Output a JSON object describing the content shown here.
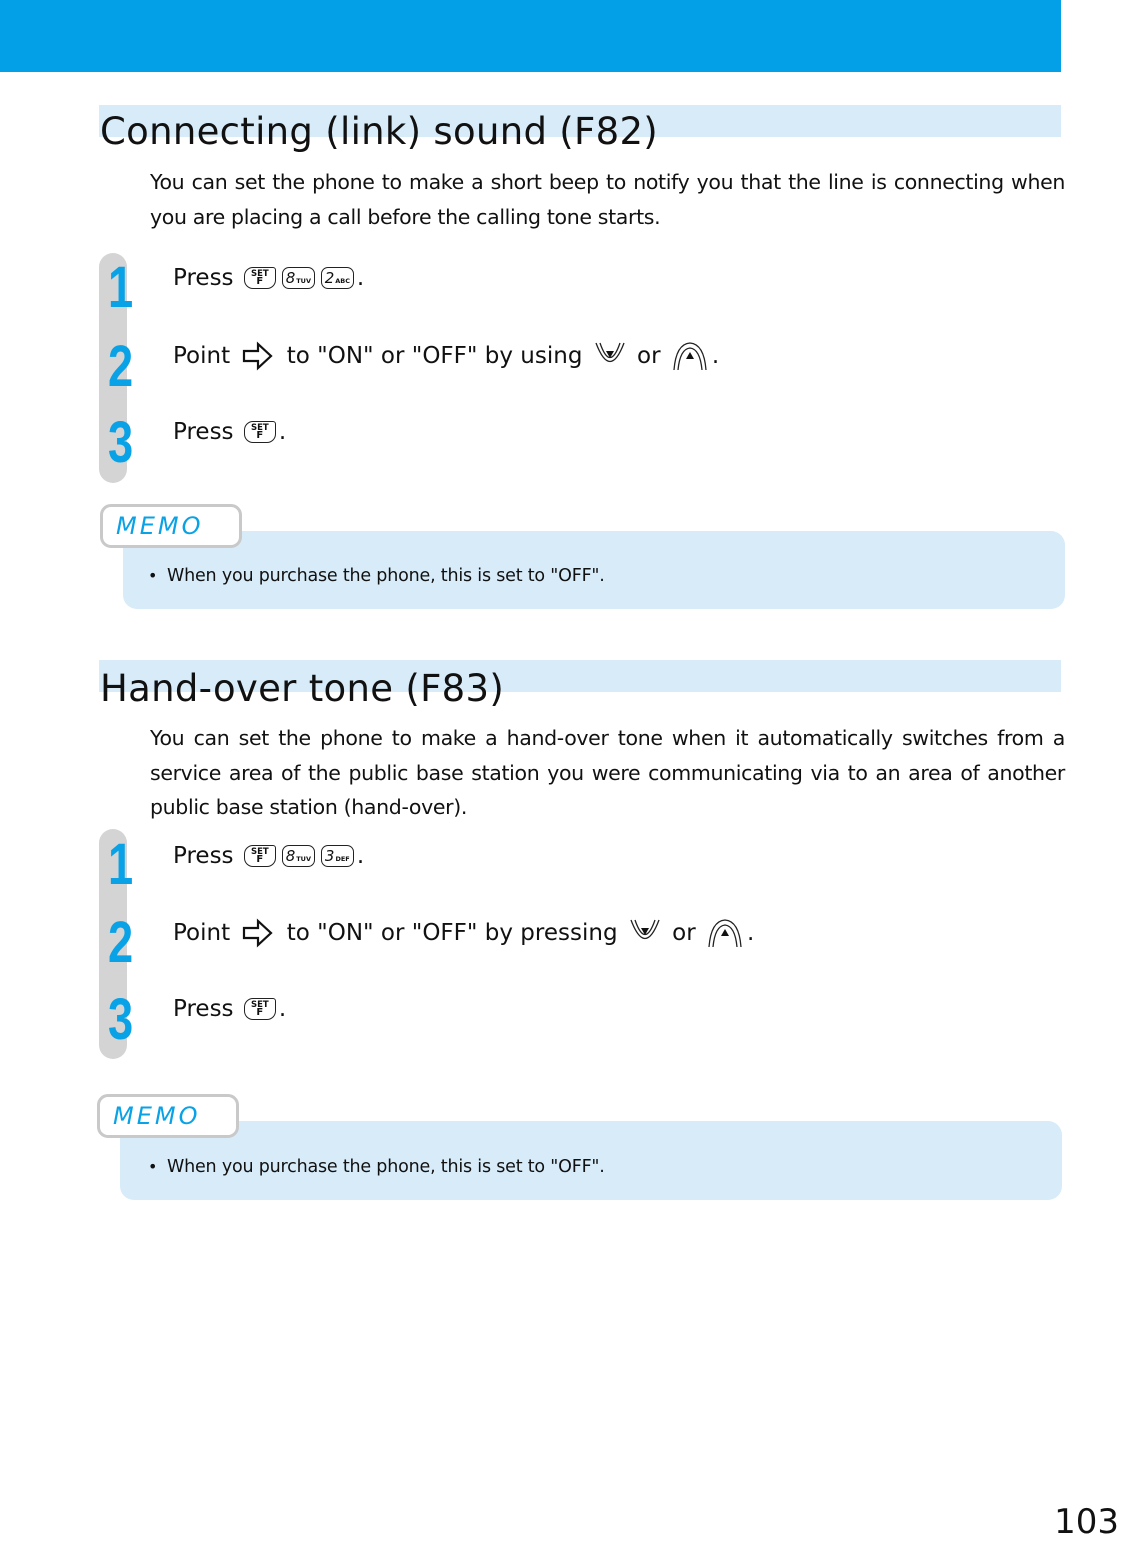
{
  "page": {
    "page_number": "103",
    "accent_color": "#03a0e8",
    "band_color": "#d7ebf9"
  },
  "sections": [
    {
      "title": "Connecting (link) sound (F82)",
      "description": "You can set the phone to make a short beep to notify you that the line is connecting when you are placing a call before the calling tone starts.",
      "steps": [
        {
          "number": "1",
          "prefix": "Press ",
          "keys": [
            {
              "type": "set",
              "top": "SET",
              "bottom": "F"
            },
            {
              "type": "num",
              "digit": "8",
              "letters": "TUV"
            },
            {
              "type": "num",
              "digit": "2",
              "letters": "ABC"
            }
          ],
          "suffix": "."
        },
        {
          "number": "2",
          "prefix": "Point ",
          "icon": "cursor-arrow-icon",
          "middle": " to \"ON\" or \"OFF\" by using ",
          "or": " or ",
          "suffix": "."
        },
        {
          "number": "3",
          "prefix": "Press ",
          "keys": [
            {
              "type": "set",
              "top": "SET",
              "bottom": "F"
            }
          ],
          "suffix": "."
        }
      ],
      "memo": {
        "label": "MEMO",
        "bullet": "•",
        "text": "When you purchase the phone, this is set to \"OFF\"."
      }
    },
    {
      "title": "Hand-over tone (F83)",
      "description": "You can set the phone to make a hand-over tone when it automatically switches from a service area of the public base station you were communicating via to an area of another public base station (hand-over).",
      "steps": [
        {
          "number": "1",
          "prefix": "Press ",
          "keys": [
            {
              "type": "set",
              "top": "SET",
              "bottom": "F"
            },
            {
              "type": "num",
              "digit": "8",
              "letters": "TUV"
            },
            {
              "type": "num",
              "digit": "3",
              "letters": "DEF"
            }
          ],
          "suffix": "."
        },
        {
          "number": "2",
          "prefix": "Point ",
          "icon": "cursor-arrow-icon",
          "middle": " to \"ON\" or \"OFF\" by pressing ",
          "or": " or ",
          "suffix": "."
        },
        {
          "number": "3",
          "prefix": "Press ",
          "keys": [
            {
              "type": "set",
              "top": "SET",
              "bottom": "F"
            }
          ],
          "suffix": "."
        }
      ],
      "memo": {
        "label": "MEMO",
        "bullet": "•",
        "text": "When you purchase the phone, this is set to \"OFF\"."
      }
    }
  ]
}
